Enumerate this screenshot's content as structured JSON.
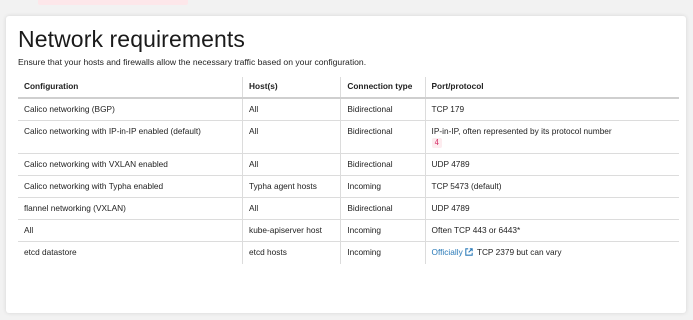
{
  "page": {
    "title": "Network requirements",
    "subtitle": "Ensure that your hosts and firewalls allow the necessary traffic based on your configuration."
  },
  "table": {
    "headers": {
      "configuration": "Configuration",
      "hosts": "Host(s)",
      "connection_type": "Connection type",
      "port_protocol": "Port/protocol"
    },
    "rows": [
      {
        "configuration": "Calico networking (BGP)",
        "hosts": "All",
        "connection_type": "Bidirectional",
        "port_protocol": "TCP 179"
      },
      {
        "configuration": "Calico networking with IP-in-IP enabled (default)",
        "hosts": "All",
        "connection_type": "Bidirectional",
        "port_protocol": "IP-in-IP, often represented by its protocol number",
        "port_protocol_code": "4"
      },
      {
        "configuration": "Calico networking with VXLAN enabled",
        "hosts": "All",
        "connection_type": "Bidirectional",
        "port_protocol": "UDP 4789"
      },
      {
        "configuration": "Calico networking with Typha enabled",
        "hosts": "Typha agent hosts",
        "connection_type": "Incoming",
        "port_protocol": "TCP 5473 (default)"
      },
      {
        "configuration": "flannel networking (VXLAN)",
        "hosts": "All",
        "connection_type": "Bidirectional",
        "port_protocol": "UDP 4789"
      },
      {
        "configuration": "All",
        "hosts": "kube-apiserver host",
        "connection_type": "Incoming",
        "port_protocol": "Often TCP 443 or 6443*"
      },
      {
        "configuration": "etcd datastore",
        "hosts": "etcd hosts",
        "connection_type": "Incoming",
        "port_protocol_link": "Officially",
        "port_protocol_link_icon": "external-link-icon",
        "port_protocol": "TCP 2379 but can vary"
      }
    ]
  },
  "colors": {
    "background": "#f2f2f2",
    "card": "#ffffff",
    "link": "#2a7ab8",
    "code_text": "#d6336c",
    "code_bg": "#fdecef"
  }
}
